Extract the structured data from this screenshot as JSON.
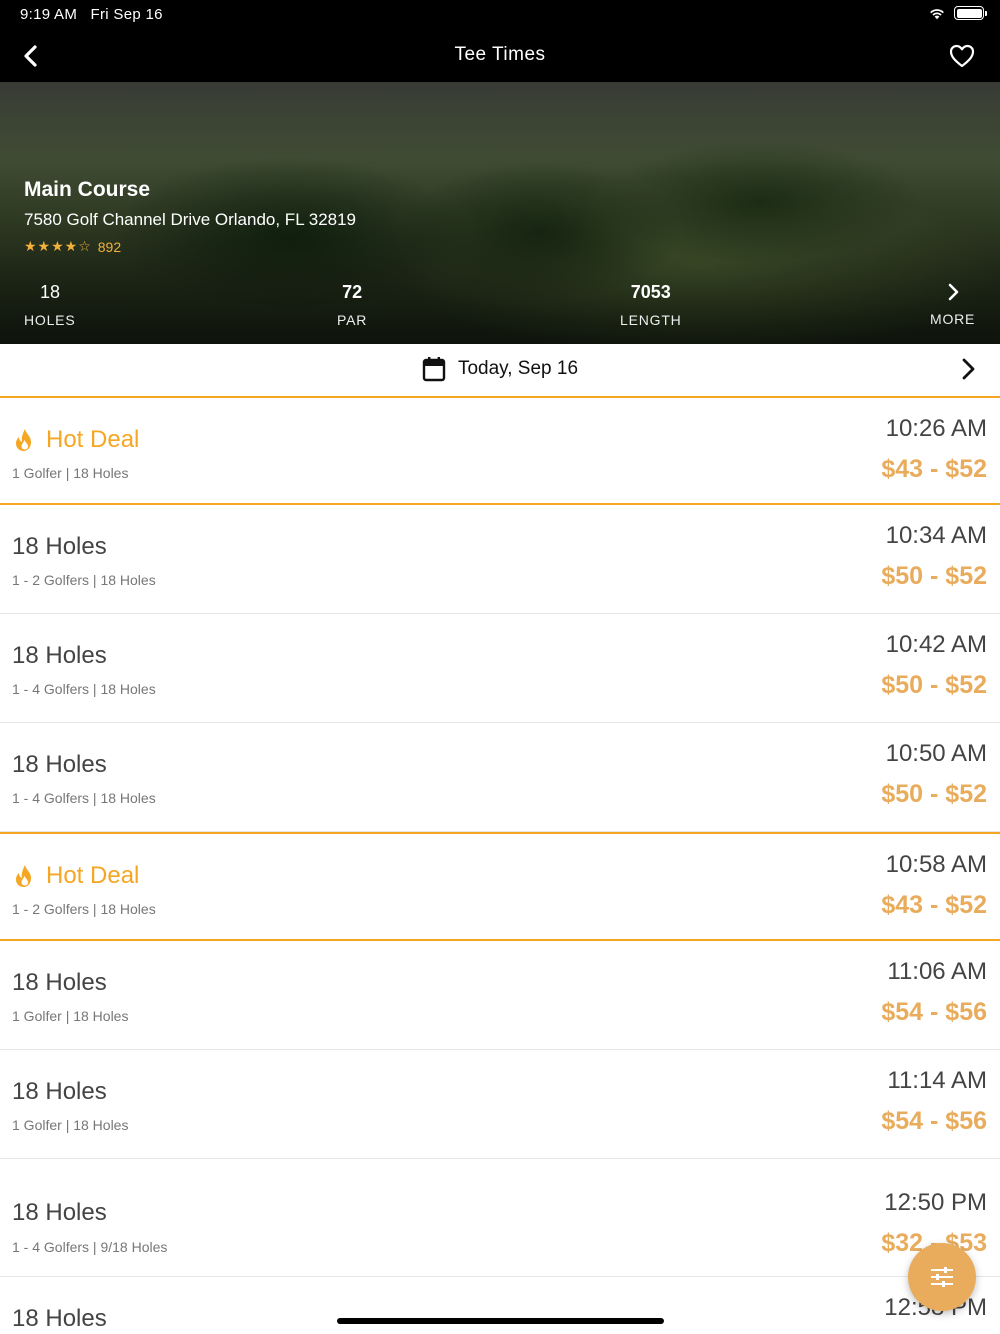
{
  "status_bar": {
    "time": "9:19 AM",
    "date": "Fri Sep 16"
  },
  "nav": {
    "title": "Tee Times",
    "back_icon": "chevron-left-icon",
    "favorite_icon": "heart-icon"
  },
  "course": {
    "name": "Main Course",
    "address": "7580 Golf Channel Drive Orlando, FL 32819",
    "rating": 4,
    "rating_max": 5,
    "review_count": "892",
    "stats": {
      "holes_value": "18",
      "holes_label": "HOLES",
      "par_value": "72",
      "par_label": "PAR",
      "length_value": "7053",
      "length_label": "LENGTH",
      "more_label": "MORE"
    }
  },
  "date_selector": {
    "label": "Today, Sep 16"
  },
  "tee_times": [
    {
      "title": "Hot Deal",
      "hot": true,
      "details": "1 Golfer | 18 Holes",
      "time": "10:26 AM",
      "price": "$43 - $52"
    },
    {
      "title": "18 Holes",
      "hot": false,
      "details": "1 - 2 Golfers | 18 Holes",
      "time": "10:34 AM",
      "price": "$50 - $52"
    },
    {
      "title": "18 Holes",
      "hot": false,
      "details": "1 - 4 Golfers | 18 Holes",
      "time": "10:42 AM",
      "price": "$50 - $52"
    },
    {
      "title": "18 Holes",
      "hot": false,
      "details": "1 - 4 Golfers | 18 Holes",
      "time": "10:50 AM",
      "price": "$50 - $52"
    },
    {
      "title": "Hot Deal",
      "hot": true,
      "details": "1 - 2 Golfers | 18 Holes",
      "time": "10:58 AM",
      "price": "$43 - $52"
    },
    {
      "title": "18 Holes",
      "hot": false,
      "details": "1 Golfer | 18 Holes",
      "time": "11:06 AM",
      "price": "$54 - $56"
    },
    {
      "title": "18 Holes",
      "hot": false,
      "details": "1 Golfer | 18 Holes",
      "time": "11:14 AM",
      "price": "$54 - $56"
    },
    {
      "title": "18 Holes",
      "hot": false,
      "details": "1 - 4 Golfers | 9/18 Holes",
      "time": "12:50 PM",
      "price": "$32 - $53"
    },
    {
      "title": "18 Holes",
      "hot": false,
      "details": "",
      "time": "12:58 PM",
      "price": ""
    }
  ],
  "colors": {
    "accent": "#f5a622",
    "price": "#e8ac5c",
    "bar": "#000000"
  },
  "filter_button_icon": "sliders-icon"
}
